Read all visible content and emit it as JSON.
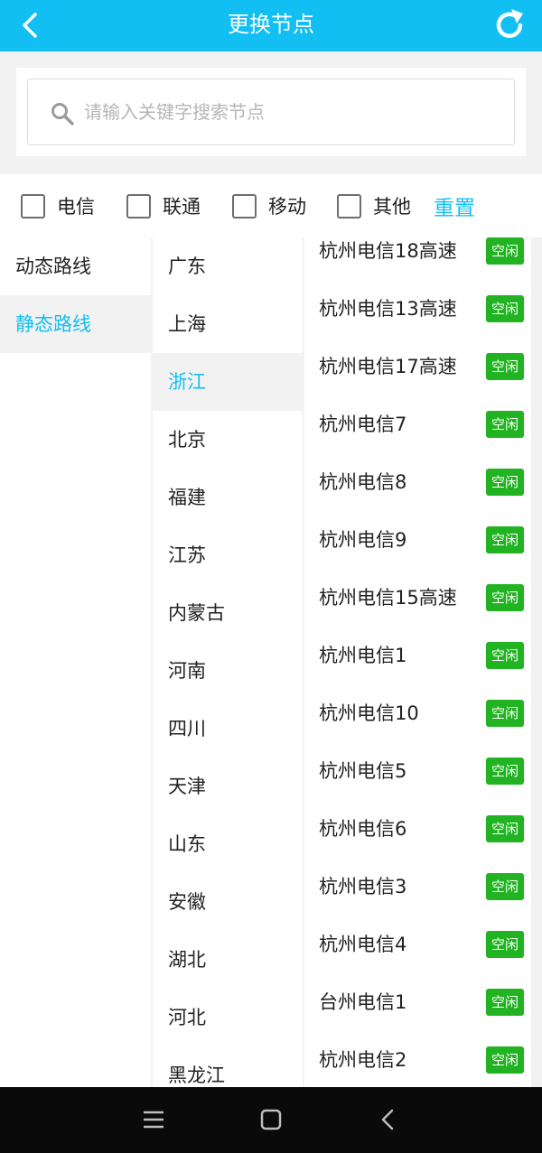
{
  "header": {
    "title": "更换节点"
  },
  "search": {
    "placeholder": "请输入关键字搜索节点",
    "value": ""
  },
  "filters": [
    {
      "label": "电信",
      "checked": false
    },
    {
      "label": "联通",
      "checked": false
    },
    {
      "label": "移动",
      "checked": false
    },
    {
      "label": "其他",
      "checked": false
    }
  ],
  "reset_label": "重置",
  "route_types": [
    {
      "label": "动态路线",
      "active": false
    },
    {
      "label": "静态路线",
      "active": true
    }
  ],
  "provinces": [
    {
      "label": "广东",
      "active": false
    },
    {
      "label": "上海",
      "active": false
    },
    {
      "label": "浙江",
      "active": true
    },
    {
      "label": "北京",
      "active": false
    },
    {
      "label": "福建",
      "active": false
    },
    {
      "label": "江苏",
      "active": false
    },
    {
      "label": "内蒙古",
      "active": false
    },
    {
      "label": "河南",
      "active": false
    },
    {
      "label": "四川",
      "active": false
    },
    {
      "label": "天津",
      "active": false
    },
    {
      "label": "山东",
      "active": false
    },
    {
      "label": "安徽",
      "active": false
    },
    {
      "label": "湖北",
      "active": false
    },
    {
      "label": "河北",
      "active": false
    },
    {
      "label": "黑龙江",
      "active": false
    }
  ],
  "nodes": [
    {
      "name": "杭州电信18高速",
      "status": "空闲"
    },
    {
      "name": "杭州电信13高速",
      "status": "空闲"
    },
    {
      "name": "杭州电信17高速",
      "status": "空闲"
    },
    {
      "name": "杭州电信7",
      "status": "空闲"
    },
    {
      "name": "杭州电信8",
      "status": "空闲"
    },
    {
      "name": "杭州电信9",
      "status": "空闲"
    },
    {
      "name": "杭州电信15高速",
      "status": "空闲"
    },
    {
      "name": "杭州电信1",
      "status": "空闲"
    },
    {
      "name": "杭州电信10",
      "status": "空闲"
    },
    {
      "name": "杭州电信5",
      "status": "空闲"
    },
    {
      "name": "杭州电信6",
      "status": "空闲"
    },
    {
      "name": "杭州电信3",
      "status": "空闲"
    },
    {
      "name": "杭州电信4",
      "status": "空闲"
    },
    {
      "name": "台州电信1",
      "status": "空闲"
    },
    {
      "name": "杭州电信2",
      "status": "空闲"
    }
  ],
  "colors": {
    "accent": "#12bff2",
    "status_idle": "#21b321"
  },
  "icons": {
    "back": "chevron-left-icon",
    "refresh": "refresh-icon",
    "search": "search-icon",
    "nav_menu": "menu-icon",
    "nav_home": "home-icon",
    "nav_back": "back-icon"
  }
}
